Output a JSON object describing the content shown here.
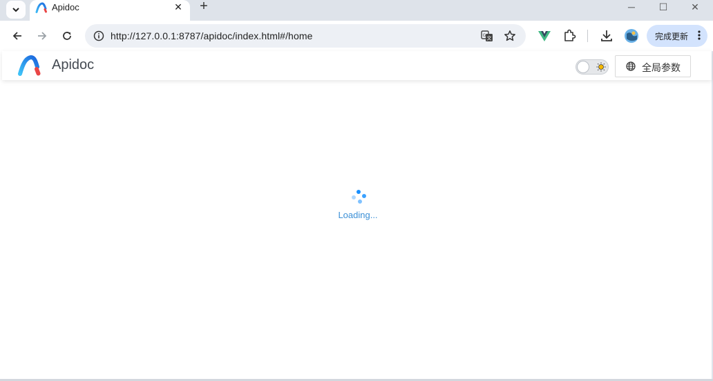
{
  "browser": {
    "tab": {
      "title": "Apidoc",
      "close_symbol": "✕"
    },
    "new_tab_symbol": "+",
    "address_url": "http://127.0.0.1:8787/apidoc/index.html#/home",
    "update_button_label": "完成更新",
    "window_controls": {
      "minimize": "─",
      "maximize": "☐",
      "close": "✕"
    }
  },
  "app": {
    "brand": "Apidoc",
    "global_params_label": "全局参数",
    "loading_text": "Loading...",
    "colors": {
      "accent": "#1890ff",
      "loading": "#3a8fd6"
    }
  }
}
